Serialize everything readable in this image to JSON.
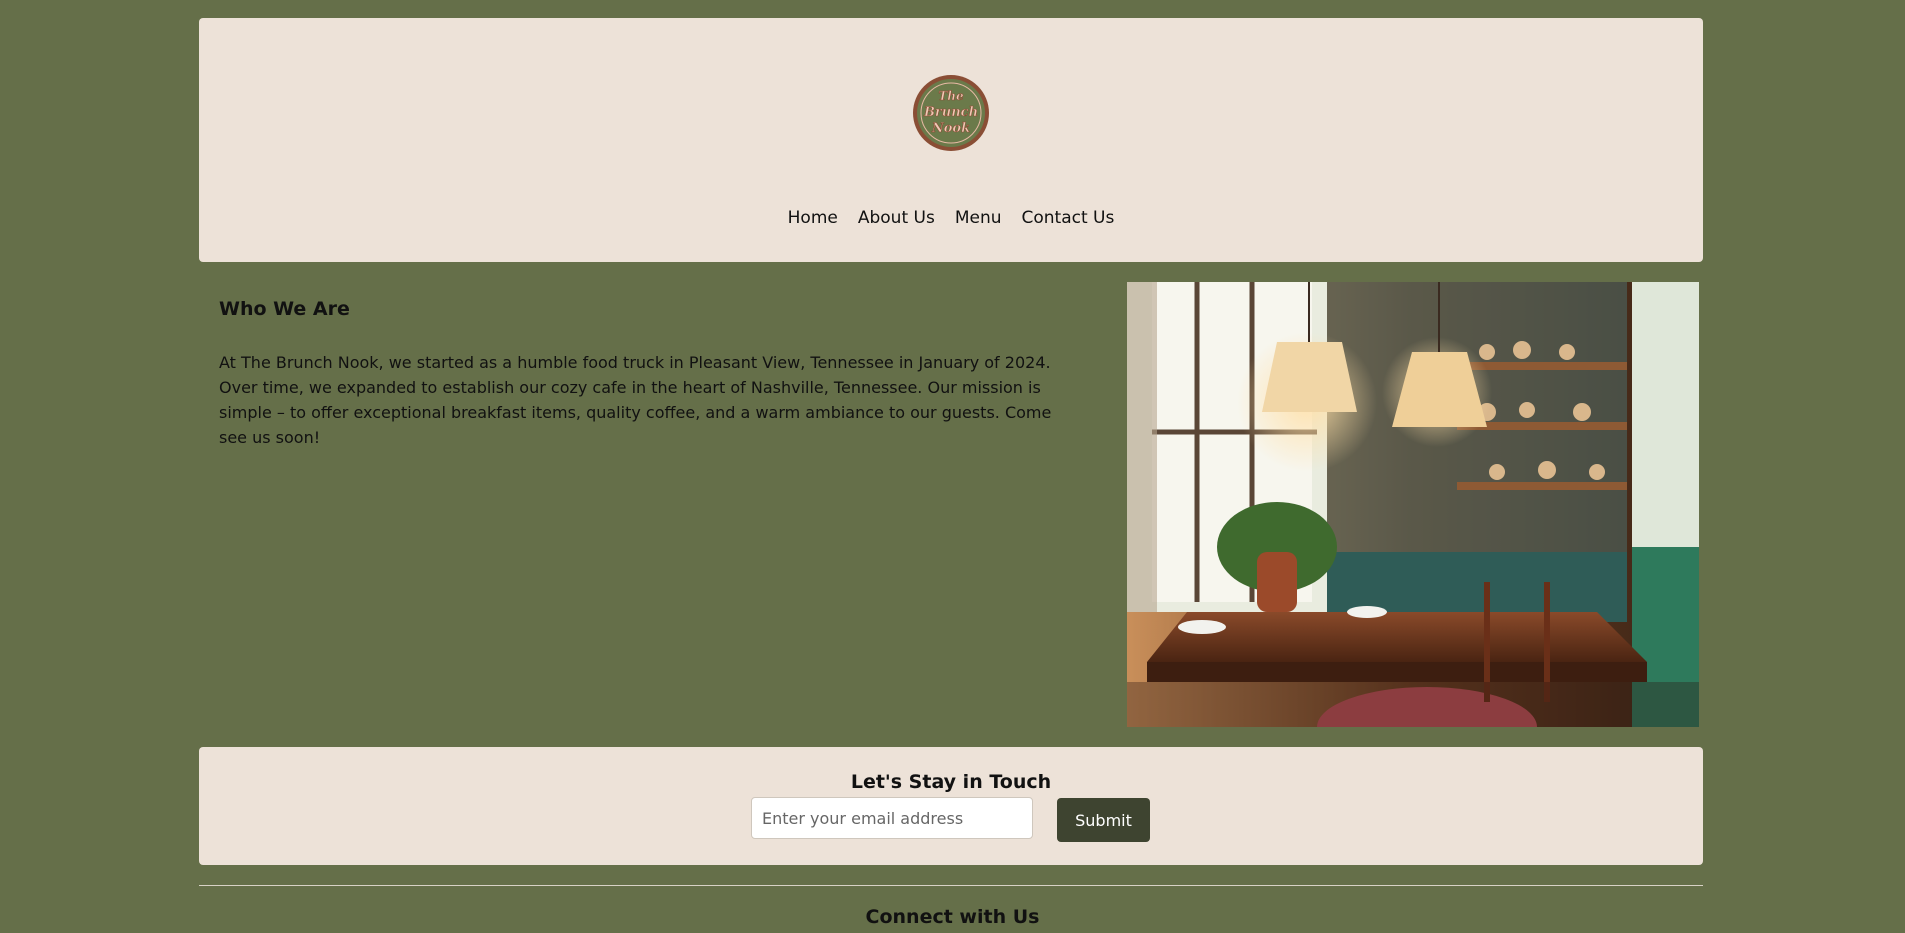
{
  "colors": {
    "background": "#656f49",
    "panel": "#ede2d8",
    "accent_dark": "#3e4430",
    "logo_green": "#6b7a4a",
    "logo_brown": "#8a4e35"
  },
  "header": {
    "logo": {
      "text_lines": [
        "The",
        "Brunch",
        "Nook"
      ]
    },
    "nav": {
      "items": [
        {
          "label": "Home"
        },
        {
          "label": "About Us"
        },
        {
          "label": "Menu"
        },
        {
          "label": "Contact Us"
        }
      ]
    }
  },
  "about": {
    "heading": "Who We Are",
    "body": "At The Brunch Nook, we started as a humble food truck in Pleasant View, Tennessee in January of 2024. Over time, we expanded to establish our cozy cafe in the heart of Nashville, Tennessee. Our mission is simple – to offer exceptional breakfast items, quality coffee, and a warm ambiance to our guests. Come see us soon!",
    "image_icon": "cafe-interior-photo"
  },
  "newsletter": {
    "heading": "Let's Stay in Touch",
    "email_placeholder": "Enter your email address",
    "email_value": "",
    "submit_label": "Submit"
  },
  "footer": {
    "heading": "Connect with Us"
  }
}
